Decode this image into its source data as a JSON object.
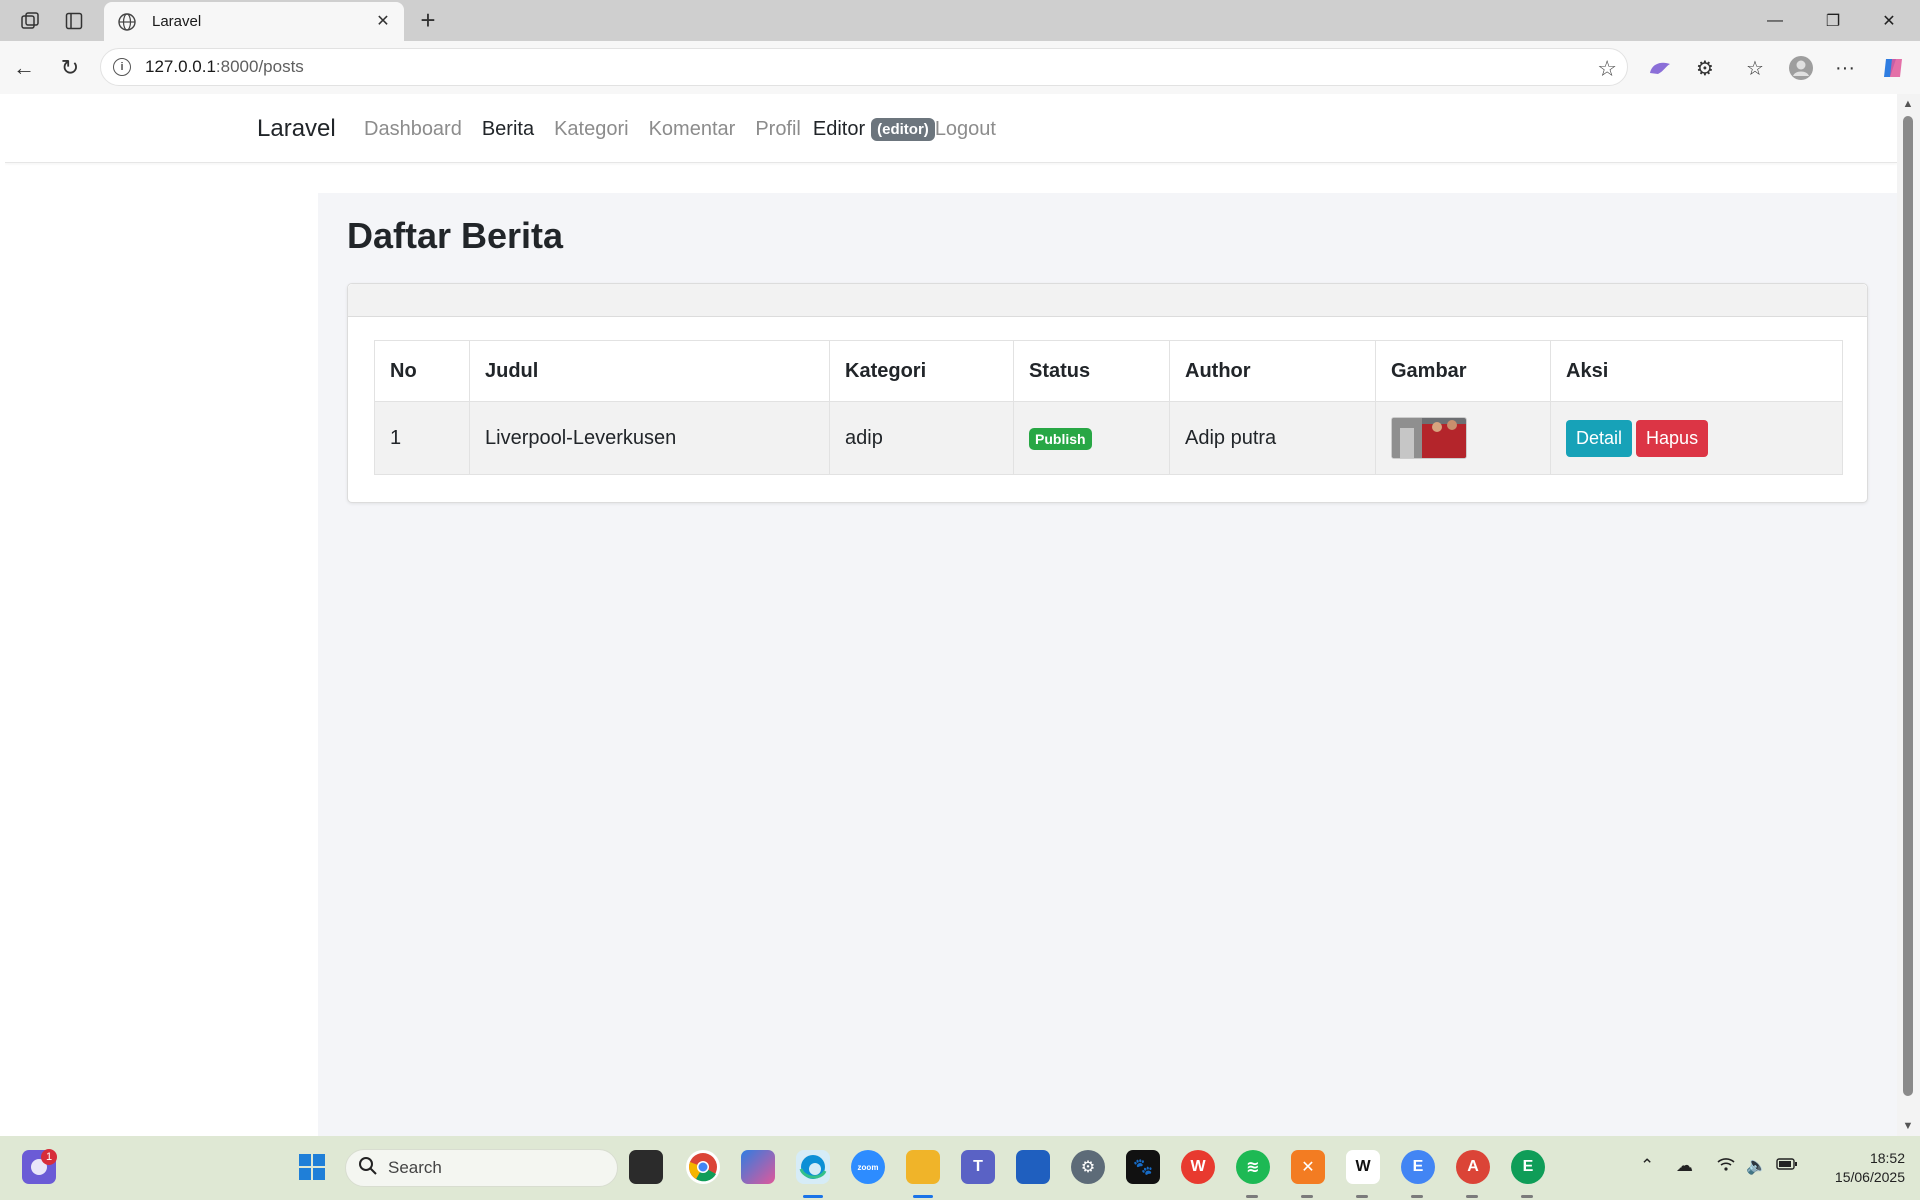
{
  "browser": {
    "tab_title": "Laravel",
    "url_host": "127.0.0.1",
    "url_path": ":8000/posts"
  },
  "navbar": {
    "brand": "Laravel",
    "links": [
      "Dashboard",
      "Berita",
      "Kategori",
      "Komentar",
      "Profil"
    ],
    "active_link": "Berita",
    "user_name": "Editor",
    "user_role": "(editor)",
    "logout": "Logout"
  },
  "page": {
    "title": "Daftar Berita"
  },
  "table": {
    "headers": [
      "No",
      "Judul",
      "Kategori",
      "Status",
      "Author",
      "Gambar",
      "Aksi"
    ],
    "rows": [
      {
        "no": "1",
        "judul": "Liverpool-Leverkusen",
        "kategori": "adip",
        "status": "Publish",
        "author": "Adip putra",
        "detail_label": "Detail",
        "hapus_label": "Hapus"
      }
    ]
  },
  "taskbar": {
    "search_placeholder": "Search",
    "time": "18:52",
    "date": "15/06/2025",
    "notification_count": "1"
  },
  "colors": {
    "status_publish": "#28a745",
    "btn_detail": "#17a2b8",
    "btn_hapus": "#dc3545",
    "role_badge": "#6c757d"
  }
}
